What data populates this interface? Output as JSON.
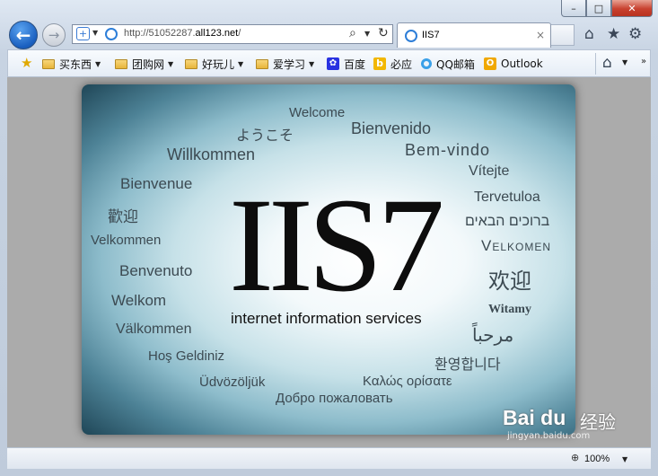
{
  "window": {
    "caption_buttons": [
      "–",
      "□",
      "✕"
    ]
  },
  "nav": {
    "back_icon": "back-arrow-icon",
    "forward_icon": "forward-arrow-icon",
    "address_prefix": "http://51052287.",
    "address_domain": "all123.net",
    "address_suffix": "/",
    "tab_title": "IIS7",
    "tab_close": "×"
  },
  "favorites": {
    "items": [
      {
        "label": "买东西",
        "dropdown": true
      },
      {
        "label": "团购网",
        "dropdown": true
      },
      {
        "label": "好玩儿",
        "dropdown": true
      },
      {
        "label": "爱学习",
        "dropdown": true
      },
      {
        "label": "百度",
        "dropdown": false
      },
      {
        "label": "必应",
        "dropdown": false
      },
      {
        "label": "QQ邮箱",
        "dropdown": false
      },
      {
        "label": "Outlook",
        "dropdown": false
      }
    ]
  },
  "iis": {
    "title": "IIS7",
    "subtitle": "internet information services",
    "words": [
      "Welcome",
      "ようこそ",
      "Bienvenido",
      "Willkommen",
      "Bem-vindo",
      "Vítejte",
      "Bienvenue",
      "Tervetuloa",
      "歡迎",
      "ברוכים הבאים",
      "Velkommen",
      "Velkomen",
      "Benvenuto",
      "欢迎",
      "Welkom",
      "Witamy",
      "Välkommen",
      "مرحباً",
      "Hoş Geldiniz",
      "환영합니다",
      "Üdvözöljük",
      "Καλώς ορίσατε",
      "Добро пожаловать"
    ]
  },
  "status": {
    "zoom": "100%"
  },
  "watermark": {
    "brand": "Bai du",
    "suffix": "经验",
    "url": "jingyan.baidu.com"
  }
}
